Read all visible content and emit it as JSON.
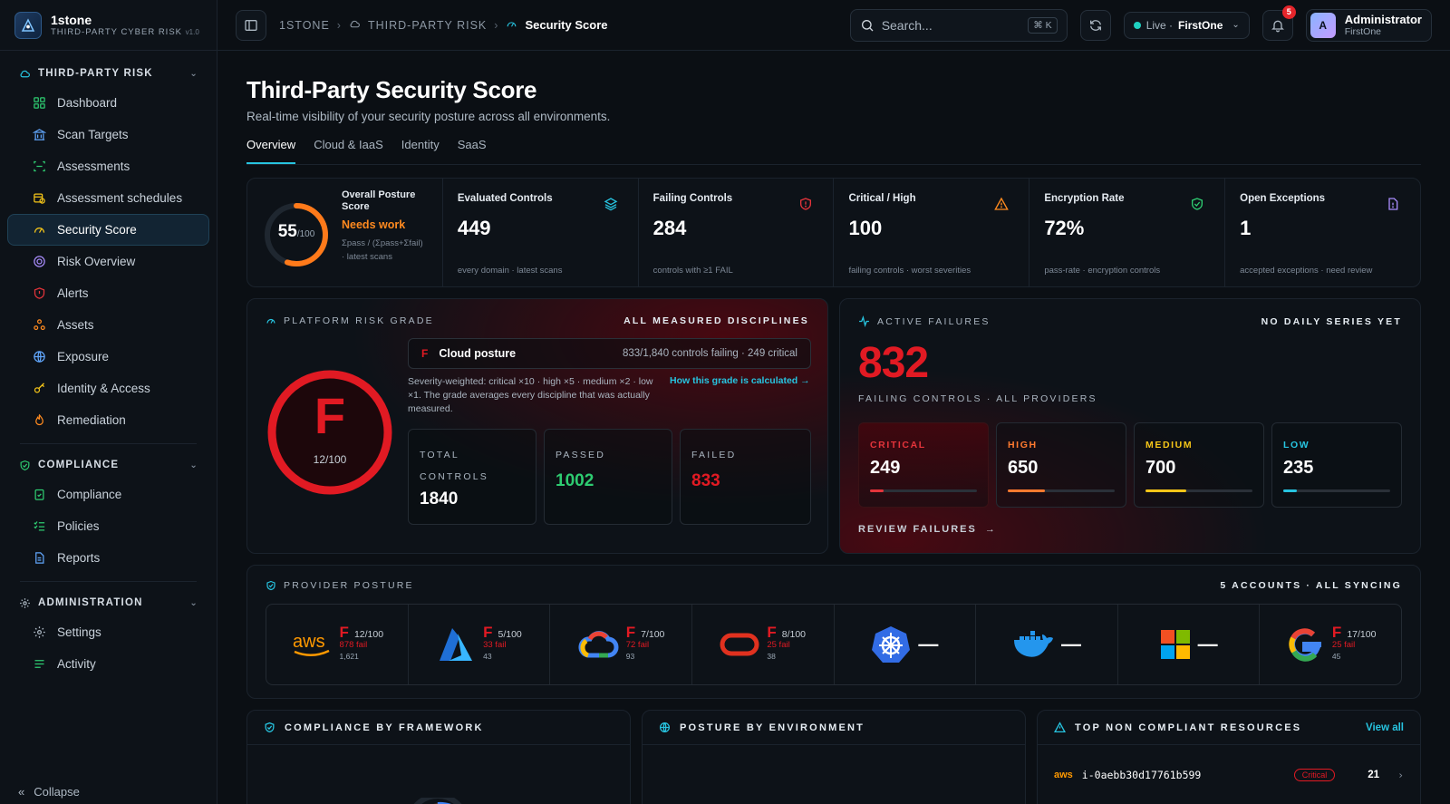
{
  "brand": {
    "name": "1stone",
    "sub": "THIRD-PARTY CYBER RISK",
    "version": "v1.0"
  },
  "nav": {
    "sections": [
      {
        "title": "THIRD-PARTY RISK",
        "items": [
          "Dashboard",
          "Scan Targets",
          "Assessments",
          "Assessment schedules",
          "Security Score",
          "Risk Overview",
          "Alerts",
          "Assets",
          "Exposure",
          "Identity & Access",
          "Remediation"
        ]
      },
      {
        "title": "COMPLIANCE",
        "items": [
          "Compliance",
          "Policies",
          "Reports"
        ]
      },
      {
        "title": "ADMINISTRATION",
        "items": [
          "Settings",
          "Activity"
        ]
      }
    ],
    "collapse": "Collapse"
  },
  "topbar": {
    "crumbs": [
      "1STONE",
      "THIRD-PARTY RISK",
      "Security Score"
    ],
    "search_placeholder": "Search...",
    "kbd": "⌘ K",
    "live_label": "Live ·",
    "live_org": "FirstOne",
    "notif_count": "5",
    "user_initial": "A",
    "user_name": "Administrator",
    "user_org": "FirstOne"
  },
  "page": {
    "title": "Third-Party Security Score",
    "subtitle": "Real-time visibility of your security posture across all environments.",
    "tabs": [
      "Overview",
      "Cloud & IaaS",
      "Identity",
      "SaaS"
    ]
  },
  "kpis": {
    "overall": {
      "label": "Overall Posture Score",
      "value": "55",
      "max": "/100",
      "score": 55,
      "status": "Needs work",
      "note": "Σpass / (Σpass+Σfail) · latest scans"
    },
    "items": [
      {
        "label": "Evaluated Controls",
        "value": "449",
        "note": "every domain · latest scans",
        "icon": "layers-icon",
        "color": "#27c4e0"
      },
      {
        "label": "Failing Controls",
        "value": "284",
        "note": "controls with ≥1 FAIL",
        "icon": "shield-alert-icon",
        "color": "#e5343b"
      },
      {
        "label": "Critical / High",
        "value": "100",
        "note": "failing controls · worst severities",
        "icon": "warning-icon",
        "color": "#ff8a1f"
      },
      {
        "label": "Encryption Rate",
        "value": "72%",
        "note": "pass-rate · encryption controls",
        "icon": "shield-check-icon",
        "color": "#2ecc71"
      },
      {
        "label": "Open Exceptions",
        "value": "1",
        "note": "accepted exceptions · need review",
        "icon": "file-exception-icon",
        "color": "#a78bfa"
      }
    ]
  },
  "risk": {
    "title": "PLATFORM RISK GRADE",
    "right": "ALL MEASURED DISCIPLINES",
    "grade": "F",
    "score": "12/100",
    "score_value": 12,
    "discipline": {
      "grade": "F",
      "name": "Cloud posture",
      "detail": "833/1,840 controls failing · 249 critical"
    },
    "explain": "Severity-weighted: critical ×10 · high ×5 · medium ×2 · low ×1. The grade averages every discipline that was actually measured.",
    "how_link": "How this grade is calculated →",
    "totals": [
      {
        "label": "TOTAL CONTROLS",
        "value": "1840",
        "color": "#ffffff"
      },
      {
        "label": "PASSED",
        "value": "1002",
        "color": "#2ecc71"
      },
      {
        "label": "FAILED",
        "value": "833",
        "color": "#e11a23"
      }
    ]
  },
  "failures": {
    "title": "ACTIVE FAILURES",
    "right": "NO DAILY SERIES YET",
    "count": "832",
    "sub": "FAILING CONTROLS · ALL PROVIDERS",
    "severities": [
      {
        "label": "CRITICAL",
        "value": "249",
        "color": "#e5343b",
        "fill": 0.13
      },
      {
        "label": "HIGH",
        "value": "650",
        "color": "#ff7a2f",
        "fill": 0.35
      },
      {
        "label": "MEDIUM",
        "value": "700",
        "color": "#f5c518",
        "fill": 0.38
      },
      {
        "label": "LOW",
        "value": "235",
        "color": "#27c4e0",
        "fill": 0.13
      }
    ],
    "review": "REVIEW FAILURES"
  },
  "providers": {
    "title": "PROVIDER POSTURE",
    "right": "5 ACCOUNTS · ALL SYNCING",
    "items": [
      {
        "name": "aws",
        "icon": "aws-logo-icon",
        "grade": "F",
        "score": "12/100",
        "fail": "878 fail",
        "total": "1,621"
      },
      {
        "name": "azure",
        "icon": "azure-logo-icon",
        "grade": "F",
        "score": "5/100",
        "fail": "33 fail",
        "total": "43"
      },
      {
        "name": "gcp",
        "icon": "gcp-logo-icon",
        "grade": "F",
        "score": "7/100",
        "fail": "72 fail",
        "total": "93"
      },
      {
        "name": "oracle",
        "icon": "oracle-logo-icon",
        "grade": "F",
        "score": "8/100",
        "fail": "25 fail",
        "total": "38"
      },
      {
        "name": "kubernetes",
        "icon": "kubernetes-logo-icon",
        "dash": "—"
      },
      {
        "name": "docker",
        "icon": "docker-logo-icon",
        "dash": "—"
      },
      {
        "name": "microsoft",
        "icon": "microsoft-logo-icon",
        "dash": "—"
      },
      {
        "name": "google",
        "icon": "google-logo-icon",
        "grade": "F",
        "score": "17/100",
        "fail": "25 fail",
        "total": "45"
      }
    ]
  },
  "bottom": {
    "compliance_title": "COMPLIANCE BY FRAMEWORK",
    "environment_title": "POSTURE BY ENVIRONMENT",
    "resources_title": "TOP NON COMPLIANT RESOURCES",
    "view_all": "View all",
    "resource": {
      "provider": "aws",
      "id": "i-0aebb30d17761b599",
      "badge": "Critical",
      "count": "21"
    }
  }
}
